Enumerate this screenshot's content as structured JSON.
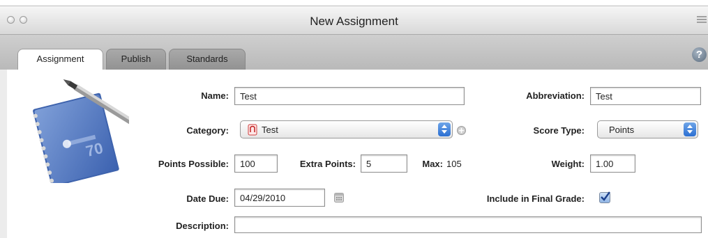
{
  "window": {
    "title": "New Assignment"
  },
  "tabs": [
    {
      "label": "Assignment",
      "active": true
    },
    {
      "label": "Publish",
      "active": false
    },
    {
      "label": "Standards",
      "active": false
    }
  ],
  "help": {
    "glyph": "?"
  },
  "form": {
    "name": {
      "label": "Name:",
      "value": "Test"
    },
    "abbreviation": {
      "label": "Abbreviation:",
      "value": "Test"
    },
    "category": {
      "label": "Category:",
      "value": "Test"
    },
    "score_type": {
      "label": "Score Type:",
      "value": "Points"
    },
    "points_possible": {
      "label": "Points Possible:",
      "value": "100"
    },
    "extra_points": {
      "label": "Extra Points:",
      "value": "5"
    },
    "max": {
      "label": "Max:",
      "value": "105"
    },
    "weight": {
      "label": "Weight:",
      "value": "1.00"
    },
    "date_due": {
      "label": "Date Due:",
      "value": "04/29/2010"
    },
    "include_final": {
      "label": "Include in Final Grade:",
      "checked": true
    },
    "description": {
      "label": "Description:",
      "value": ""
    }
  },
  "icons": {
    "notebook": "notebook-pen-icon",
    "category": "category-tag-icon",
    "add": "add-circle-icon",
    "calendar": "calendar-icon",
    "help": "help-icon",
    "menu": "menu-icon"
  },
  "colors": {
    "accent": "#2b6fd2",
    "notebook": "#4a6fb5"
  }
}
